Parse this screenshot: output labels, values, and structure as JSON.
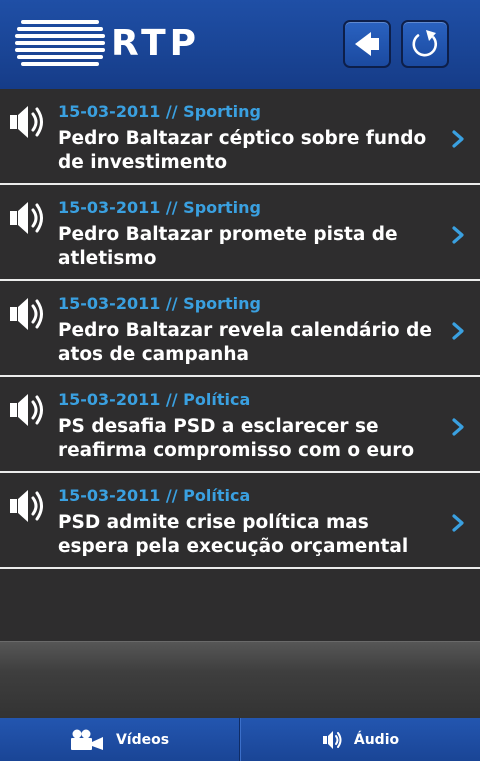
{
  "header": {
    "logo_text": "RTP",
    "back_icon": "back-arrow-icon",
    "refresh_icon": "refresh-icon",
    "background_color": "#1a4596"
  },
  "items": [
    {
      "date_category": "15-03-2011 // Sporting",
      "title": "Pedro Baltazar céptico sobre fundo de investimento"
    },
    {
      "date_category": "15-03-2011 // Sporting",
      "title": "Pedro Baltazar promete pista de atletismo"
    },
    {
      "date_category": "15-03-2011 // Sporting",
      "title": "Pedro Baltazar revela calendário de atos de campanha"
    },
    {
      "date_category": "15-03-2011 // Política",
      "title": "PS desafia PSD a esclarecer se reafirma compromisso com o euro"
    },
    {
      "date_category": "15-03-2011 // Política",
      "title": "PSD admite crise política mas espera pela execução orçamental"
    }
  ],
  "item_icon": "speaker-icon",
  "accent_color": "#3aa0e0",
  "tabs": [
    {
      "label": "Vídeos",
      "icon": "video-camera-icon"
    },
    {
      "label": "Áudio",
      "icon": "speaker-icon"
    }
  ]
}
